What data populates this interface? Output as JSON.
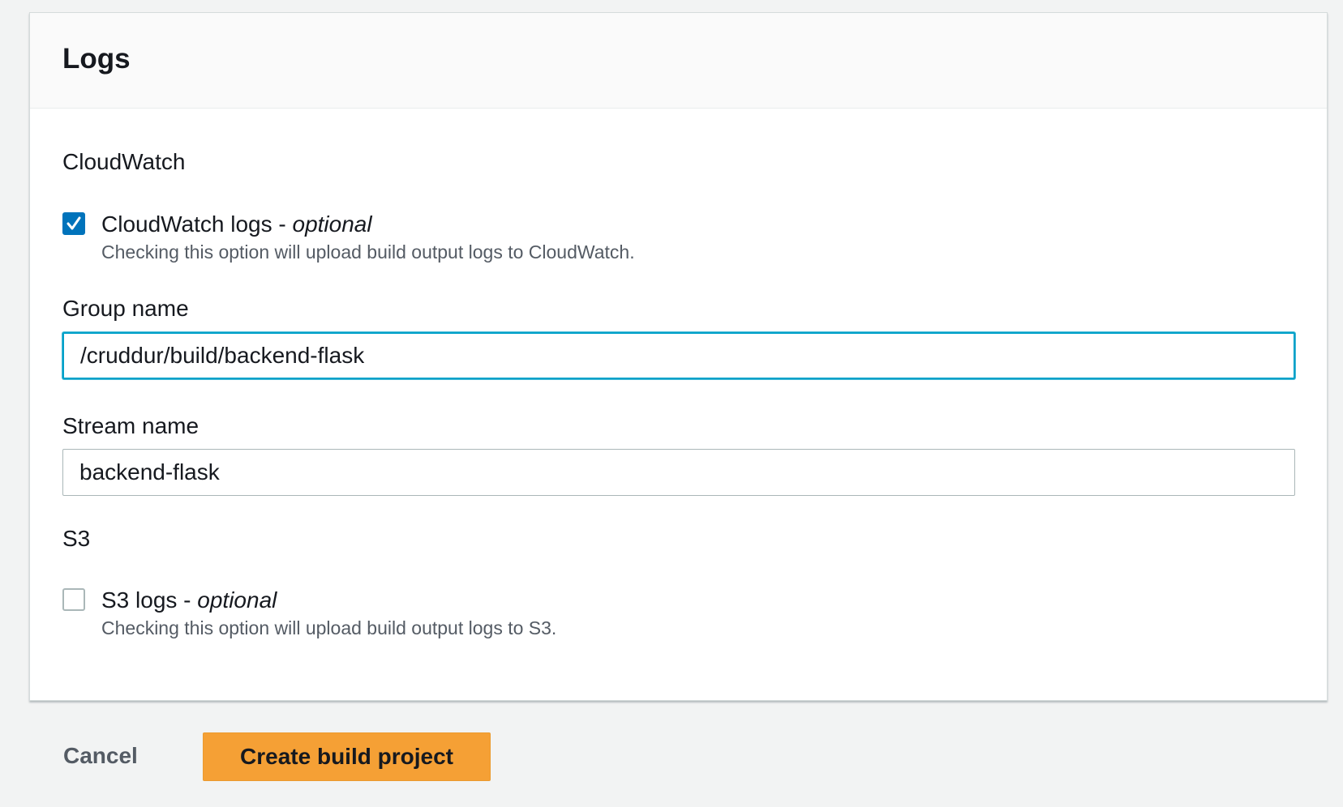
{
  "panel": {
    "title": "Logs"
  },
  "cloudwatch": {
    "section_title": "CloudWatch",
    "checkbox": {
      "label": "CloudWatch logs - ",
      "label_optional": "optional",
      "description": "Checking this option will upload build output logs to CloudWatch.",
      "checked": true
    },
    "group_name": {
      "label": "Group name",
      "value": "/cruddur/build/backend-flask"
    },
    "stream_name": {
      "label": "Stream name",
      "value": "backend-flask"
    }
  },
  "s3": {
    "section_title": "S3",
    "checkbox": {
      "label": "S3 logs - ",
      "label_optional": "optional",
      "description": "Checking this option will upload build output logs to S3.",
      "checked": false
    }
  },
  "footer": {
    "cancel_label": "Cancel",
    "submit_label": "Create build project"
  },
  "colors": {
    "accent": "#0073bb",
    "focus": "#00a1c9",
    "primary_button": "#f5a035"
  }
}
